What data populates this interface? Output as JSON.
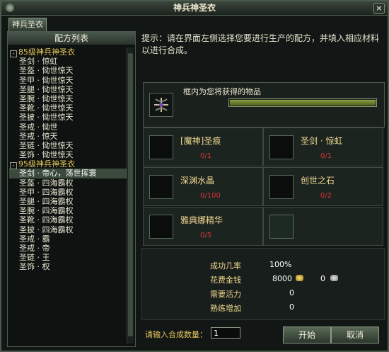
{
  "window": {
    "title": "神兵神圣衣",
    "close_glyph": "×"
  },
  "tab": {
    "label": "神兵圣衣"
  },
  "list": {
    "header": "配方列表",
    "groups": [
      {
        "label": "85级神兵神圣衣",
        "toggle": "-",
        "items": [
          "圣剑 · 惊虹",
          "圣盔 · 恸世惊天",
          "圣甲 · 恸世惊天",
          "圣腿 · 恸世惊天",
          "圣腕 · 恸世惊天",
          "圣靴 · 恸世惊天",
          "圣披 · 恸世惊天",
          "圣戒 · 恸世",
          "圣戒 · 惊天",
          "圣链 · 恸世惊天",
          "圣饰 · 恸世惊天"
        ]
      },
      {
        "label": "95级神兵神圣衣",
        "toggle": "-",
        "items": [
          "圣剑 · 帝心，荡世挥寰",
          "圣盔 · 四海霸权",
          "圣甲 · 四海霸权",
          "圣腿 · 四海霸权",
          "圣腕 · 四海霸权",
          "圣靴 · 四海霸权",
          "圣披 · 四海霸权",
          "圣戒 · 霸",
          "圣戒 · 帝",
          "圣链 · 王",
          "圣饰 · 权"
        ]
      }
    ],
    "selected": "圣剑 · 帝心，荡世挥寰"
  },
  "hint": "提示：请在界面左侧选择您要进行生产的配方，并填入相应材料以进行合成。",
  "result": {
    "label": "框内为您将获得的物品",
    "progress": 1.0,
    "icon": "crossbow-icon"
  },
  "materials": [
    {
      "name": "[魔神]圣痕",
      "count": "0/1"
    },
    {
      "name": "圣剑 · 惊虹",
      "count": "0/1"
    },
    {
      "name": "深渊水晶",
      "count": "0/100"
    },
    {
      "name": "创世之石",
      "count": "0/2"
    },
    {
      "name": "雅典娜精华",
      "count": "0/5"
    },
    {
      "name": "",
      "count": ""
    }
  ],
  "stats": {
    "success_label": "成功几率",
    "success_value": "100%",
    "cost_label": "花费金钱",
    "gold": "8000",
    "silver": "0",
    "vitality_label": "需要活力",
    "vitality": "0",
    "skill_label": "熟练增加",
    "skill": "0"
  },
  "quantity": {
    "label": "请输入合成数量：",
    "value": "1"
  },
  "buttons": {
    "start": "开始",
    "cancel": "取消"
  },
  "colors": {
    "accent": "#e8c45c",
    "count_red": "#d8343a"
  }
}
